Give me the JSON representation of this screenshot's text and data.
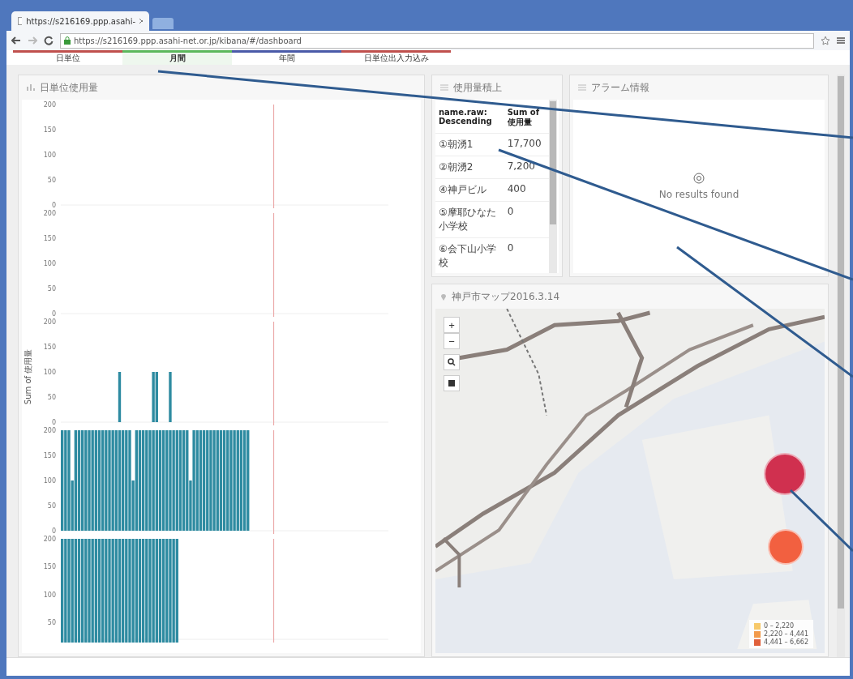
{
  "browser": {
    "tab_title": "https://s216169.ppp.asahi-",
    "address": "https://s216169.ppp.asahi-net.or.jp/kibana/#/dashboard"
  },
  "nav_tabs": [
    {
      "label": "日単位",
      "color": "#c0504d",
      "selected": false
    },
    {
      "label": "月間",
      "color": "#5cb85c",
      "selected": true
    },
    {
      "label": "年間",
      "color": "#4a5aa8",
      "selected": false
    },
    {
      "label": "日単位出入力込み",
      "color": "#c0504d",
      "selected": false
    }
  ],
  "usage_panel": {
    "title": "日単位使用量",
    "ylabel": "Sum of 使用量",
    "charts": [
      {
        "chart_data": {
          "type": "bar",
          "ylim": [
            0,
            200
          ],
          "yticks": [
            0,
            50,
            100,
            150,
            200
          ],
          "categories": [
            null
          ],
          "values": [
            0
          ]
        }
      },
      {
        "chart_data": {
          "type": "bar",
          "ylim": [
            0,
            200
          ],
          "yticks": [
            0,
            50,
            100,
            150,
            200
          ],
          "categories": [
            null
          ],
          "values": [
            0
          ]
        }
      },
      {
        "chart_data": {
          "type": "bar",
          "ylim": [
            0,
            200
          ],
          "yticks": [
            0,
            50,
            100,
            150,
            200
          ],
          "categories": [
            null,
            null,
            null,
            null,
            null,
            null,
            null,
            null,
            null,
            null,
            null,
            null,
            null,
            null,
            null,
            null,
            null,
            null,
            null,
            null,
            null,
            null,
            null,
            null,
            null,
            null,
            null,
            null,
            null,
            null,
            null,
            null,
            null,
            null,
            null,
            null,
            null,
            null,
            null,
            null,
            null,
            null,
            null,
            null,
            null,
            null,
            null,
            null,
            null,
            null,
            null,
            null,
            null,
            null,
            null,
            null,
            null,
            null,
            null,
            null,
            null,
            null,
            null,
            null,
            null,
            null,
            null,
            null,
            null,
            null,
            null,
            null,
            null,
            null,
            null,
            null,
            null,
            null,
            null,
            null,
            null,
            null,
            null,
            null,
            null,
            null,
            null,
            null,
            null,
            null,
            null,
            null,
            null,
            null,
            null,
            null,
            null
          ],
          "values": [
            0,
            0,
            0,
            0,
            0,
            0,
            0,
            0,
            0,
            0,
            0,
            0,
            0,
            0,
            0,
            0,
            0,
            100,
            0,
            0,
            0,
            0,
            0,
            0,
            0,
            0,
            0,
            100,
            100,
            0,
            0,
            0,
            100,
            0,
            0,
            0,
            0,
            0,
            0,
            0,
            0,
            0,
            0,
            0,
            0,
            0,
            0,
            0,
            0,
            0,
            0,
            0,
            0,
            0,
            0,
            0,
            0,
            0,
            0,
            0,
            0,
            0,
            0,
            0,
            0,
            0,
            0,
            0,
            0,
            0,
            0,
            0,
            0,
            0,
            0,
            0,
            0,
            0,
            0,
            0,
            0,
            0,
            0,
            0,
            0,
            0,
            0,
            0,
            0,
            0,
            0,
            0,
            0,
            0,
            0,
            0,
            0
          ]
        }
      },
      {
        "chart_data": {
          "type": "bar",
          "ylim": [
            0,
            200
          ],
          "yticks": [
            0,
            50,
            100,
            150,
            200
          ],
          "categories": [
            null,
            null,
            null,
            null,
            null,
            null,
            null,
            null,
            null,
            null,
            null,
            null,
            null,
            null,
            null,
            null,
            null,
            null,
            null,
            null,
            null,
            null,
            null,
            null,
            null,
            null,
            null,
            null,
            null,
            null,
            null,
            null,
            null,
            null,
            null,
            null,
            null,
            null,
            null,
            null,
            null,
            null,
            null,
            null,
            null,
            null,
            null,
            null,
            null,
            null,
            null,
            null,
            null,
            null,
            null,
            null,
            null,
            null,
            null,
            null,
            null,
            null,
            null,
            null,
            null,
            null,
            null,
            null,
            null,
            null,
            null,
            null,
            null,
            null,
            null,
            null,
            null,
            null,
            null,
            null,
            null,
            null,
            null,
            null,
            null,
            null,
            null,
            null,
            null,
            null,
            null,
            null,
            null,
            null,
            null,
            null,
            null
          ],
          "values": [
            200,
            200,
            200,
            100,
            200,
            200,
            200,
            200,
            200,
            200,
            200,
            200,
            200,
            200,
            200,
            200,
            200,
            200,
            200,
            200,
            200,
            100,
            200,
            200,
            200,
            200,
            200,
            200,
            200,
            200,
            200,
            200,
            200,
            200,
            200,
            200,
            200,
            200,
            100,
            200,
            200,
            200,
            200,
            200,
            200,
            200,
            200,
            200,
            200,
            200,
            200,
            200,
            200,
            200,
            200,
            200,
            0,
            0,
            0,
            0,
            0,
            0,
            0,
            0,
            0,
            0,
            0,
            0,
            0,
            0,
            0,
            0,
            0,
            0,
            0,
            0,
            0,
            0,
            0,
            0,
            0,
            0,
            0,
            0,
            0,
            0,
            0,
            0,
            0,
            0,
            0,
            0,
            0,
            0,
            0,
            0,
            0
          ]
        }
      },
      {
        "chart_data": {
          "type": "bar",
          "ylim": [
            20,
            200
          ],
          "yticks": [
            50,
            100,
            150,
            200
          ],
          "categories": [
            null,
            null,
            null,
            null,
            null,
            null,
            null,
            null,
            null,
            null,
            null,
            null,
            null,
            null,
            null,
            null,
            null,
            null,
            null,
            null,
            null,
            null,
            null,
            null,
            null,
            null,
            null,
            null,
            null,
            null,
            null,
            null,
            null,
            null,
            null,
            null,
            null,
            null,
            null,
            null,
            null,
            null,
            null,
            null,
            null,
            null,
            null,
            null,
            null,
            null,
            null,
            null,
            null,
            null,
            null,
            null,
            null,
            null,
            null,
            null,
            null,
            null,
            null,
            null,
            null,
            null,
            null,
            null,
            null,
            null,
            null,
            null,
            null,
            null,
            null,
            null,
            null,
            null,
            null,
            null,
            null,
            null,
            null,
            null,
            null,
            null,
            null,
            null,
            null,
            null,
            null,
            null,
            null,
            null,
            null,
            null,
            null
          ],
          "values": [
            200,
            200,
            200,
            200,
            200,
            200,
            200,
            200,
            200,
            200,
            200,
            200,
            200,
            200,
            200,
            200,
            200,
            200,
            200,
            200,
            200,
            200,
            200,
            200,
            200,
            200,
            200,
            200,
            200,
            200,
            200,
            200,
            200,
            200,
            200,
            null,
            null,
            null,
            null,
            null,
            null,
            null,
            null,
            null,
            null,
            null,
            null,
            null,
            null,
            null,
            null,
            null,
            null,
            null,
            null,
            null,
            null,
            null,
            null,
            null,
            null,
            null,
            null,
            null,
            null,
            null,
            null,
            null,
            null,
            null,
            null,
            null,
            null,
            null,
            null,
            null,
            null,
            null,
            null,
            null,
            null,
            null,
            null,
            null,
            null,
            null,
            null,
            null,
            null,
            null,
            null,
            null,
            null,
            null,
            null,
            null,
            null
          ]
        }
      }
    ]
  },
  "table_panel": {
    "title": "使用量積上",
    "columns": [
      "name.raw: Descending",
      "Sum of 使用量"
    ],
    "rows": [
      {
        "name": "①朝湧1",
        "value": "17,700"
      },
      {
        "name": "②朝湧2",
        "value": "7,200"
      },
      {
        "name": "④神戸ビル",
        "value": "400"
      },
      {
        "name": "⑤摩耶ひなた小学校",
        "value": "0"
      },
      {
        "name": "⑥会下山小学校",
        "value": "0"
      }
    ]
  },
  "alarm_panel": {
    "title": "アラーム情報",
    "message": "No results found"
  },
  "map_panel": {
    "title": "神戸市マップ2016.3.14",
    "zoom_in": "+",
    "zoom_out": "−",
    "markers": [
      {
        "color": "#d0304f"
      },
      {
        "color": "#f26040"
      }
    ],
    "legend": [
      {
        "label": "0 – 2,220",
        "color": "#f7c96a"
      },
      {
        "label": "2,220 – 4,441",
        "color": "#f29a4a"
      },
      {
        "label": "4,441 – 6,662",
        "color": "#e0603a"
      }
    ]
  }
}
